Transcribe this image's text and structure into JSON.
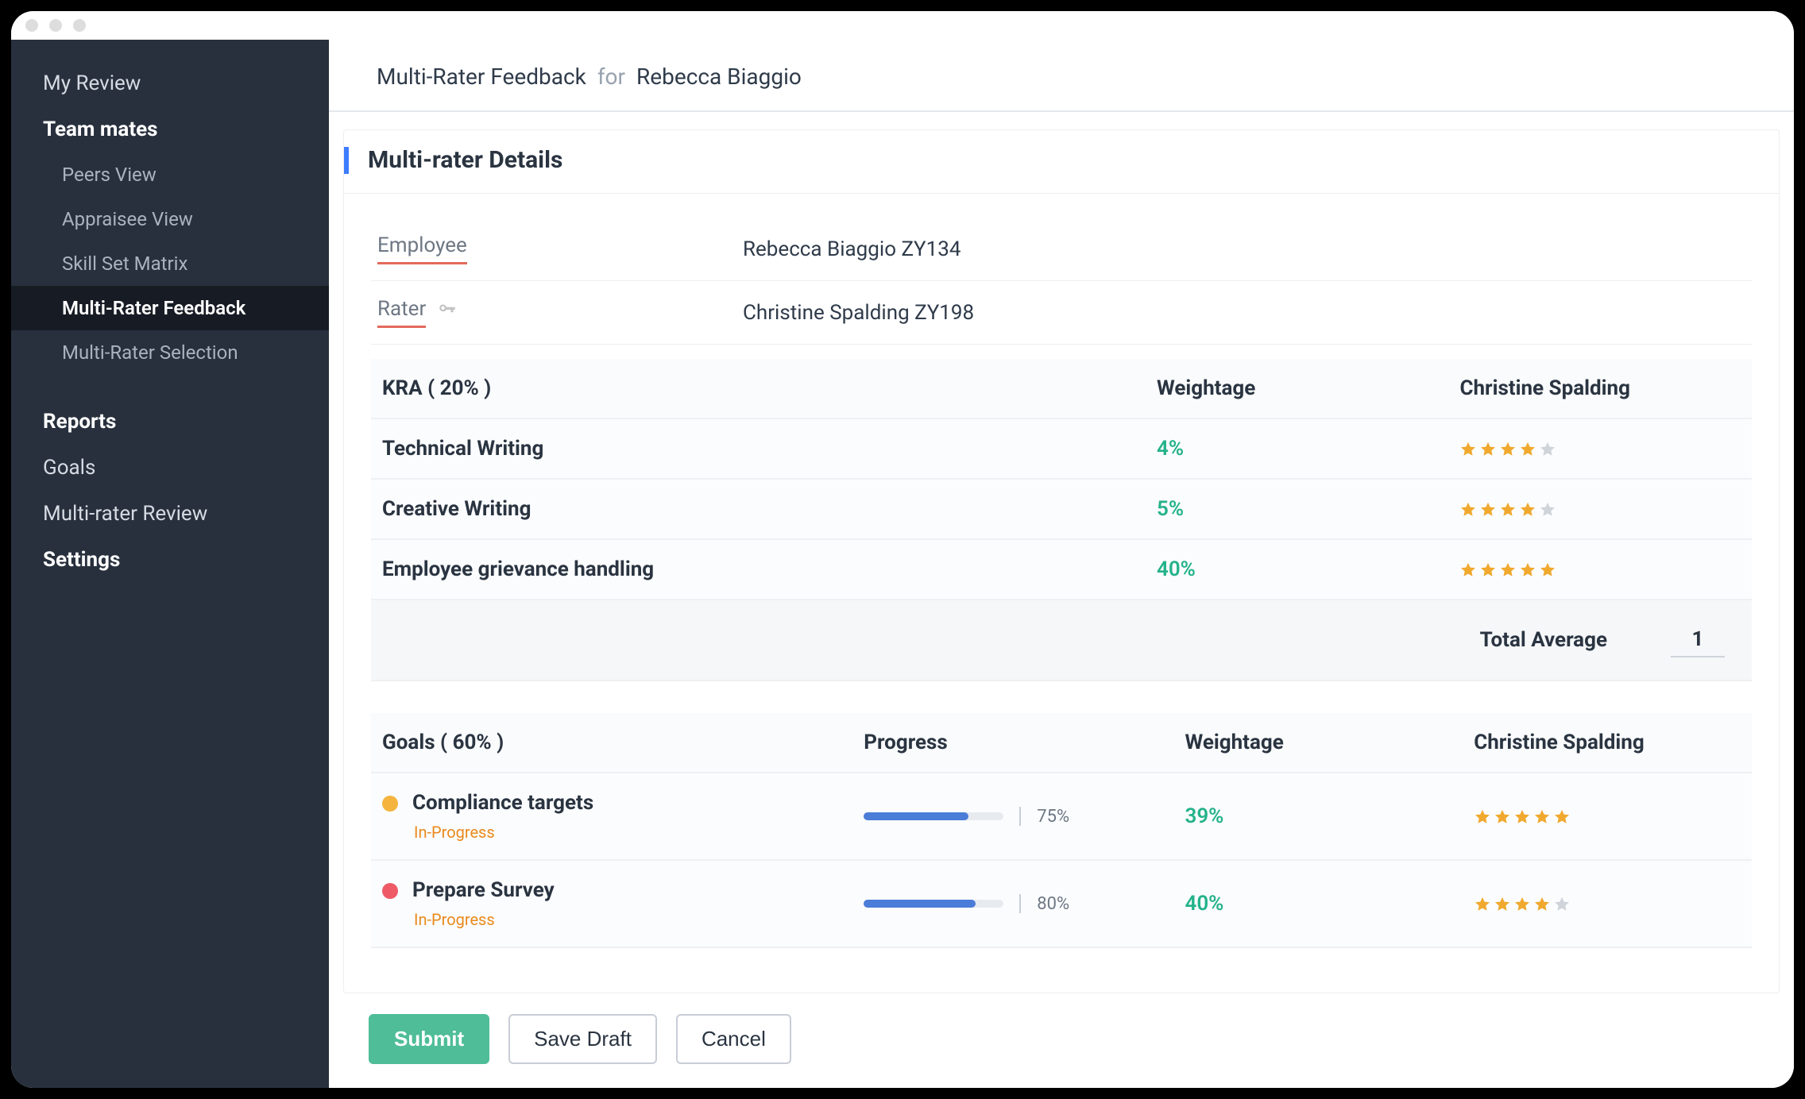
{
  "sidebar": {
    "items": [
      {
        "label": "My Review",
        "kind": "top"
      },
      {
        "label": "Team mates",
        "kind": "top bold"
      },
      {
        "label": "Peers View",
        "kind": "sub"
      },
      {
        "label": "Appraisee View",
        "kind": "sub"
      },
      {
        "label": "Skill Set Matrix",
        "kind": "sub"
      },
      {
        "label": "Multi-Rater Feedback",
        "kind": "sub active"
      },
      {
        "label": "Multi-Rater Selection",
        "kind": "sub"
      },
      {
        "label": "Reports",
        "kind": "top bold",
        "gap": true
      },
      {
        "label": "Goals",
        "kind": "top"
      },
      {
        "label": "Multi-rater Review",
        "kind": "top"
      },
      {
        "label": "Settings",
        "kind": "top bold"
      }
    ]
  },
  "header": {
    "title": "Multi-Rater Feedback",
    "for": "for",
    "person": "Rebecca Biaggio"
  },
  "panel": {
    "title": "Multi-rater Details",
    "employee_label": "Employee",
    "employee_value": "Rebecca Biaggio ZY134",
    "rater_label": "Rater",
    "rater_value": "Christine Spalding ZY198"
  },
  "kra": {
    "header_label": "KRA ( 20% )",
    "weight_label": "Weightage",
    "rater_label": "Christine Spalding",
    "rows": [
      {
        "name": "Technical Writing",
        "weight": "4%",
        "stars": 4
      },
      {
        "name": "Creative Writing",
        "weight": "5%",
        "stars": 4
      },
      {
        "name": "Employee grievance handling",
        "weight": "40%",
        "stars": 5
      }
    ],
    "total_label": "Total Average",
    "total_value": "1"
  },
  "goals": {
    "header_label": "Goals ( 60% )",
    "progress_label": "Progress",
    "weight_label": "Weightage",
    "rater_label": "Christine Spalding",
    "rows": [
      {
        "dot": "orange",
        "name": "Compliance targets",
        "status": "In-Progress",
        "progress": 75,
        "progress_text": "75%",
        "weight": "39%",
        "stars": 5
      },
      {
        "dot": "red",
        "name": "Prepare Survey",
        "status": "In-Progress",
        "progress": 80,
        "progress_text": "80%",
        "weight": "40%",
        "stars": 4
      }
    ]
  },
  "buttons": {
    "submit": "Submit",
    "save_draft": "Save Draft",
    "cancel": "Cancel"
  }
}
